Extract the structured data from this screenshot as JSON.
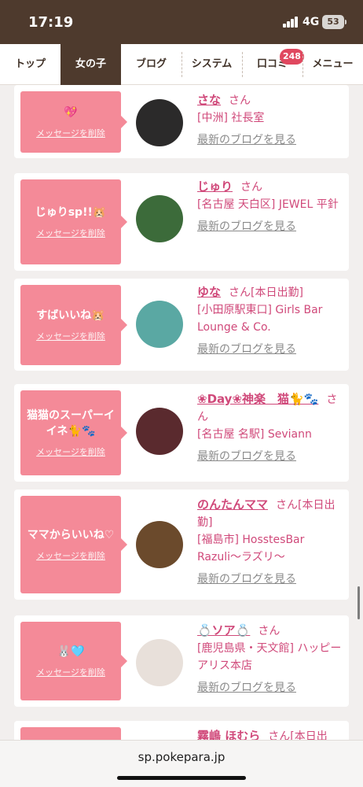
{
  "status": {
    "time": "17:19",
    "network": "4G",
    "battery": "53"
  },
  "nav": {
    "tabs": [
      {
        "label": "トップ"
      },
      {
        "label": "女の子"
      },
      {
        "label": "ブログ"
      },
      {
        "label": "システム"
      },
      {
        "label": "口コミ"
      },
      {
        "label": "メニュー"
      }
    ],
    "active_tab": "女の子",
    "kuchikomi_badge": "248"
  },
  "delete_label": "メッセージを削除",
  "blog_label": "最新のブログを見る",
  "cards": [
    {
      "message": "💖",
      "name": "さな",
      "suffix": "さん",
      "shop": "[中洲] 社長室",
      "avatar_color": "#2b2a2a"
    },
    {
      "message": "じゅりsp!!🐹",
      "name": "じゅり",
      "suffix": "さん",
      "shop": "[名古屋 天白区] JEWEL 平針",
      "avatar_color": "#3c6b3a"
    },
    {
      "message": "すばいいね🐹",
      "name": "ゆな",
      "suffix": "さん[本日出勤]",
      "shop": "[小田原駅東口] Girls Bar Lounge & Co.",
      "avatar_color": "#5aa8a3"
    },
    {
      "message": "猫猫のスーパーイイネ🐈🐾",
      "name": "❀Day❀神楽　猫🐈🐾",
      "suffix": "さん",
      "shop": "[名古屋 名駅] Seviann",
      "avatar_color": "#5a2a2e"
    },
    {
      "message": "ママからいいね♡",
      "name": "のんたんママ",
      "suffix": "さん[本日出勤]",
      "shop": "[福島市] HosstesBar Razuli〜ラズリ〜",
      "avatar_color": "#6b4a2c"
    },
    {
      "message": "🐰🩵",
      "name": "💍ソア💍",
      "suffix": "さん",
      "shop": "[鹿児島県・天文館] ハッピーアリス本店",
      "avatar_color": "#e8e0da"
    },
    {
      "message": "",
      "name": "霧嶋 ほむら",
      "suffix": "さん[本日出",
      "shop": "",
      "avatar_color": "#d8c4b8"
    }
  ],
  "url": "sp.pokepara.jp",
  "colors": {
    "header": "#4e3a2d",
    "bubble": "#f48a98",
    "accent": "#d0497a",
    "badge": "#e0485f"
  }
}
